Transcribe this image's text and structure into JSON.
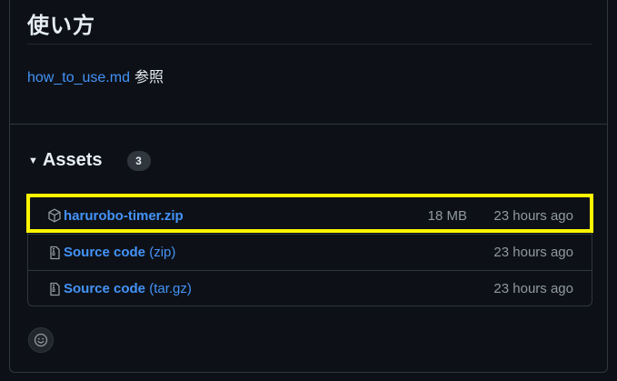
{
  "release": {
    "heading": "使い方",
    "body": {
      "link_text": "how_to_use.md",
      "trailing_text": " 参照"
    }
  },
  "assets": {
    "title": "Assets",
    "count": "3",
    "caret_icon": "triangle-down-icon",
    "items": [
      {
        "icon": "package-icon",
        "name": "harurobo-timer.zip",
        "name_suffix": "",
        "size": "18 MB",
        "time": "23 hours ago",
        "highlighted": true
      },
      {
        "icon": "file-zip-icon",
        "name": "Source code",
        "name_suffix": " (zip)",
        "size": "",
        "time": "23 hours ago",
        "highlighted": false
      },
      {
        "icon": "file-zip-icon",
        "name": "Source code",
        "name_suffix": " (tar.gz)",
        "size": "",
        "time": "23 hours ago",
        "highlighted": false
      }
    ]
  },
  "reaction": {
    "icon": "smiley-icon"
  },
  "colors": {
    "background": "#0d1117",
    "border": "#30363d",
    "link": "#4493f8",
    "muted": "#9198a1",
    "text": "#e6edf3",
    "highlight": "#fff500"
  }
}
